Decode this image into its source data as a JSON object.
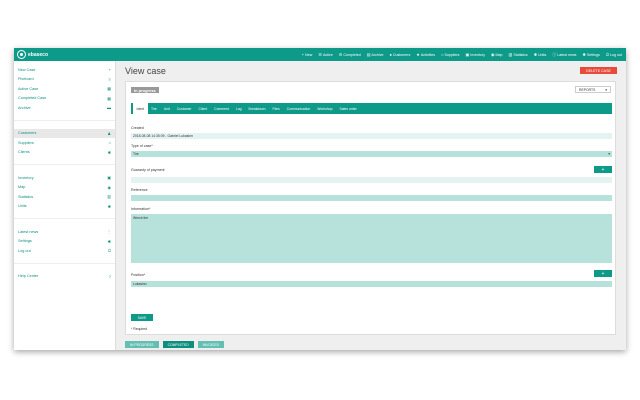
{
  "app": {
    "logo_text": "ebaseco"
  },
  "topnav": [
    {
      "icon": "plus-icon",
      "glyph": "+",
      "label": "New"
    },
    {
      "icon": "list-icon",
      "glyph": "☰",
      "label": "Active"
    },
    {
      "icon": "list-icon",
      "glyph": "☰",
      "label": "Completed"
    },
    {
      "icon": "folder-icon",
      "glyph": "▤",
      "label": "Archive"
    },
    {
      "icon": "user-icon",
      "glyph": "●",
      "label": "Customers"
    },
    {
      "icon": "star-icon",
      "glyph": "★",
      "label": "Activities"
    },
    {
      "icon": "home-icon",
      "glyph": "⌂",
      "label": "Suppliers"
    },
    {
      "icon": "box-icon",
      "glyph": "▣",
      "label": "Inventory"
    },
    {
      "icon": "map-pin-icon",
      "glyph": "◉",
      "label": "Map"
    },
    {
      "icon": "chart-icon",
      "glyph": "▥",
      "label": "Statistics"
    },
    {
      "icon": "gear-icon",
      "glyph": "✱",
      "label": "Units"
    },
    {
      "icon": "info-icon",
      "glyph": "ⓘ",
      "label": "Latest news"
    },
    {
      "icon": "gear-icon",
      "glyph": "✱",
      "label": "Settings"
    },
    {
      "icon": "logout-icon",
      "glyph": "⏻",
      "label": "Log out"
    }
  ],
  "sidebar": {
    "group1": [
      {
        "label": "New Case",
        "icon": "plus-icon",
        "glyph": "+"
      },
      {
        "label": "Pixelcard",
        "icon": "list-icon",
        "glyph": "≡"
      },
      {
        "label": "Active Case",
        "icon": "list-icon",
        "glyph": "▦"
      },
      {
        "label": "Completed Case",
        "icon": "list-icon",
        "glyph": "▦"
      },
      {
        "label": "Archive",
        "icon": "folder-icon",
        "glyph": "▬"
      }
    ],
    "group2": [
      {
        "label": "Customers",
        "icon": "user-icon",
        "glyph": "♟"
      },
      {
        "label": "Suppliers",
        "icon": "home-icon",
        "glyph": "⌂"
      },
      {
        "label": "Clients",
        "icon": "star-icon",
        "glyph": "✱"
      }
    ],
    "group3": [
      {
        "label": "Inventory",
        "icon": "box-icon",
        "glyph": "▣"
      },
      {
        "label": "Map",
        "icon": "map-pin-icon",
        "glyph": "◉"
      },
      {
        "label": "Statistics",
        "icon": "chart-icon",
        "glyph": "▥"
      },
      {
        "label": "Units",
        "icon": "gear-icon",
        "glyph": "✱"
      }
    ],
    "group4": [
      {
        "label": "Latest news",
        "icon": "info-icon",
        "glyph": "⋮"
      },
      {
        "label": "Settings",
        "icon": "gear-icon",
        "glyph": "✱"
      },
      {
        "label": "Log out",
        "icon": "logout-icon",
        "glyph": "⏻"
      }
    ],
    "help": {
      "label": "Help Center",
      "icon": "help-icon",
      "glyph": "?"
    }
  },
  "main": {
    "title": "View case",
    "delete_label": "DELETE CASE",
    "status": "In progress",
    "reports_label": "REPORTS",
    "tabs": [
      "Ident",
      "Tire",
      "Unit",
      "Customer",
      "Client",
      "Comment",
      "Log",
      "Breakdown",
      "Files",
      "Communication",
      "Workshop",
      "Sales order"
    ],
    "created_label": "Created",
    "created_value": "2018-08-08 14:35:09 - Gabriel Lukasinn",
    "type_label": "Type of case*",
    "type_value": "Tire",
    "payment_label": "Guaranty of payment",
    "reference_label": "Reference",
    "information_label": "Information*",
    "information_value": "Wreck tire",
    "position_label": "Position*",
    "position_value": "Lukasinn",
    "save_label": "SAVE",
    "required_note": "* Required"
  },
  "bottom_tabs": [
    "IN PROGRESS",
    "COMPLETED",
    "INVOICED"
  ],
  "colors": {
    "teal": "#0d9a88",
    "teal_light": "#b7e2dc",
    "danger": "#e84b3c"
  }
}
